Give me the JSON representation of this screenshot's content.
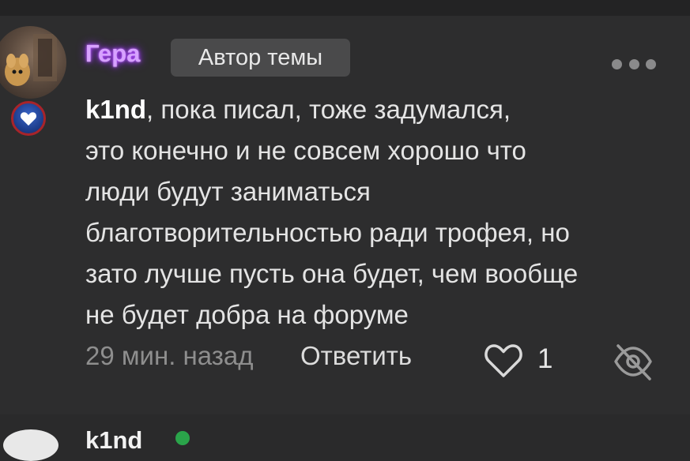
{
  "comment": {
    "username": "Гера",
    "author_badge": "Автор темы",
    "mention": "k1nd",
    "text_lines": [
      ", пока писал, тоже задумался,",
      "это конечно и не совсем хорошо что",
      "люди будут заниматься",
      "благотворительностью ради трофея, но",
      "зато лучше пусть она будет, чем вообще",
      "не будет добра на форуме"
    ],
    "time": "29 мин. назад",
    "reply_label": "Ответить",
    "like_count": "1"
  },
  "next_comment": {
    "username": "k1nd"
  },
  "icons": {
    "more": "more-dots-icon",
    "like": "heart-icon",
    "hide": "eye-off-icon",
    "badge": "heart-badge-icon"
  },
  "colors": {
    "background": "#2d2d2e",
    "username_glow": "#b042ff",
    "badge_bg": "#4a4a4b",
    "muted_text": "#8e8e8e",
    "online_dot": "#2aa44a"
  }
}
